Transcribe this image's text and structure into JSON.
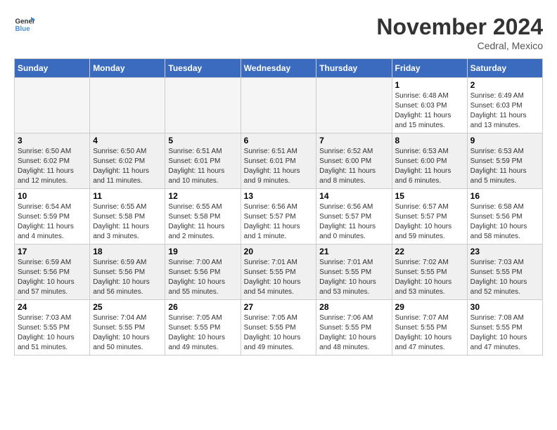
{
  "header": {
    "logo_general": "General",
    "logo_blue": "Blue",
    "month_title": "November 2024",
    "location": "Cedral, Mexico"
  },
  "days_of_week": [
    "Sunday",
    "Monday",
    "Tuesday",
    "Wednesday",
    "Thursday",
    "Friday",
    "Saturday"
  ],
  "weeks": [
    [
      {
        "day": "",
        "info": ""
      },
      {
        "day": "",
        "info": ""
      },
      {
        "day": "",
        "info": ""
      },
      {
        "day": "",
        "info": ""
      },
      {
        "day": "",
        "info": ""
      },
      {
        "day": "1",
        "info": "Sunrise: 6:48 AM\nSunset: 6:03 PM\nDaylight: 11 hours and 15 minutes."
      },
      {
        "day": "2",
        "info": "Sunrise: 6:49 AM\nSunset: 6:03 PM\nDaylight: 11 hours and 13 minutes."
      }
    ],
    [
      {
        "day": "3",
        "info": "Sunrise: 6:50 AM\nSunset: 6:02 PM\nDaylight: 11 hours and 12 minutes."
      },
      {
        "day": "4",
        "info": "Sunrise: 6:50 AM\nSunset: 6:02 PM\nDaylight: 11 hours and 11 minutes."
      },
      {
        "day": "5",
        "info": "Sunrise: 6:51 AM\nSunset: 6:01 PM\nDaylight: 11 hours and 10 minutes."
      },
      {
        "day": "6",
        "info": "Sunrise: 6:51 AM\nSunset: 6:01 PM\nDaylight: 11 hours and 9 minutes."
      },
      {
        "day": "7",
        "info": "Sunrise: 6:52 AM\nSunset: 6:00 PM\nDaylight: 11 hours and 8 minutes."
      },
      {
        "day": "8",
        "info": "Sunrise: 6:53 AM\nSunset: 6:00 PM\nDaylight: 11 hours and 6 minutes."
      },
      {
        "day": "9",
        "info": "Sunrise: 6:53 AM\nSunset: 5:59 PM\nDaylight: 11 hours and 5 minutes."
      }
    ],
    [
      {
        "day": "10",
        "info": "Sunrise: 6:54 AM\nSunset: 5:59 PM\nDaylight: 11 hours and 4 minutes."
      },
      {
        "day": "11",
        "info": "Sunrise: 6:55 AM\nSunset: 5:58 PM\nDaylight: 11 hours and 3 minutes."
      },
      {
        "day": "12",
        "info": "Sunrise: 6:55 AM\nSunset: 5:58 PM\nDaylight: 11 hours and 2 minutes."
      },
      {
        "day": "13",
        "info": "Sunrise: 6:56 AM\nSunset: 5:57 PM\nDaylight: 11 hours and 1 minute."
      },
      {
        "day": "14",
        "info": "Sunrise: 6:56 AM\nSunset: 5:57 PM\nDaylight: 11 hours and 0 minutes."
      },
      {
        "day": "15",
        "info": "Sunrise: 6:57 AM\nSunset: 5:57 PM\nDaylight: 10 hours and 59 minutes."
      },
      {
        "day": "16",
        "info": "Sunrise: 6:58 AM\nSunset: 5:56 PM\nDaylight: 10 hours and 58 minutes."
      }
    ],
    [
      {
        "day": "17",
        "info": "Sunrise: 6:59 AM\nSunset: 5:56 PM\nDaylight: 10 hours and 57 minutes."
      },
      {
        "day": "18",
        "info": "Sunrise: 6:59 AM\nSunset: 5:56 PM\nDaylight: 10 hours and 56 minutes."
      },
      {
        "day": "19",
        "info": "Sunrise: 7:00 AM\nSunset: 5:56 PM\nDaylight: 10 hours and 55 minutes."
      },
      {
        "day": "20",
        "info": "Sunrise: 7:01 AM\nSunset: 5:55 PM\nDaylight: 10 hours and 54 minutes."
      },
      {
        "day": "21",
        "info": "Sunrise: 7:01 AM\nSunset: 5:55 PM\nDaylight: 10 hours and 53 minutes."
      },
      {
        "day": "22",
        "info": "Sunrise: 7:02 AM\nSunset: 5:55 PM\nDaylight: 10 hours and 53 minutes."
      },
      {
        "day": "23",
        "info": "Sunrise: 7:03 AM\nSunset: 5:55 PM\nDaylight: 10 hours and 52 minutes."
      }
    ],
    [
      {
        "day": "24",
        "info": "Sunrise: 7:03 AM\nSunset: 5:55 PM\nDaylight: 10 hours and 51 minutes."
      },
      {
        "day": "25",
        "info": "Sunrise: 7:04 AM\nSunset: 5:55 PM\nDaylight: 10 hours and 50 minutes."
      },
      {
        "day": "26",
        "info": "Sunrise: 7:05 AM\nSunset: 5:55 PM\nDaylight: 10 hours and 49 minutes."
      },
      {
        "day": "27",
        "info": "Sunrise: 7:05 AM\nSunset: 5:55 PM\nDaylight: 10 hours and 49 minutes."
      },
      {
        "day": "28",
        "info": "Sunrise: 7:06 AM\nSunset: 5:55 PM\nDaylight: 10 hours and 48 minutes."
      },
      {
        "day": "29",
        "info": "Sunrise: 7:07 AM\nSunset: 5:55 PM\nDaylight: 10 hours and 47 minutes."
      },
      {
        "day": "30",
        "info": "Sunrise: 7:08 AM\nSunset: 5:55 PM\nDaylight: 10 hours and 47 minutes."
      }
    ]
  ]
}
